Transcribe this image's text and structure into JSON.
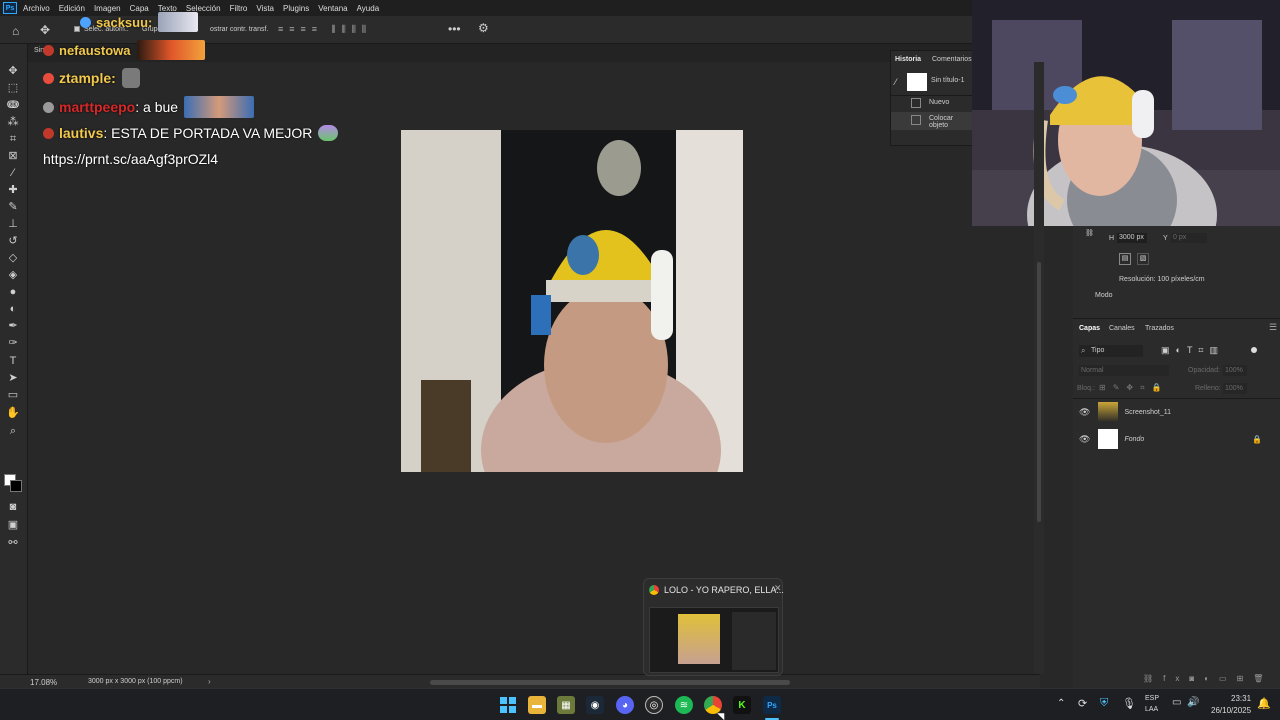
{
  "menubar": {
    "logo": "Ps",
    "items": [
      "Archivo",
      "Edición",
      "Imagen",
      "Capa",
      "Texto",
      "Selección",
      "Filtro",
      "Vista",
      "Plugins",
      "Ventana",
      "Ayuda"
    ]
  },
  "options": {
    "auto_select": "Selec. autom.:",
    "group": "Grupo",
    "show_transform": "ostrar contr. transf."
  },
  "doc_tab": "Sin tí",
  "chat": [
    {
      "user": "sacksuu:",
      "user_color": "#f2c94c",
      "badge_color": "#4da3ff",
      "text": ""
    },
    {
      "user": "nefaustowa",
      "user_color": "#f2c94c",
      "badge_color": "#c0392b",
      "text": ""
    },
    {
      "user": "ztample:",
      "user_color": "#f2c94c",
      "badge_color": "#e74c3c",
      "text": ""
    },
    {
      "user": "marttpeepo",
      "user_color": "#d62828",
      "badge_color": "#9a9a9a",
      "text": ": a bue"
    },
    {
      "user": "lautivs",
      "user_color": "#f2c94c",
      "badge_color": "#c0392b",
      "text": ": ESTA DE PORTADA VA MEJOR"
    },
    {
      "user": "",
      "user_color": "#ffffff",
      "badge_color": "",
      "text": "https://prnt.sc/aaAgf3prOZl4"
    }
  ],
  "history_panel": {
    "tab_history": "Historia",
    "tab_comments": "Comentarios",
    "snapshot": "Sin título-1",
    "steps": [
      "Nuevo",
      "Colocar objeto"
    ]
  },
  "properties": {
    "h_label": "H",
    "h_value": "3000 px",
    "y_label": "Y",
    "y_value": "0 px",
    "resolution": "Resolución: 100 píxeles/cm",
    "mode": "Modo"
  },
  "layers_panel": {
    "tabs": [
      "Capas",
      "Canales",
      "Trazados"
    ],
    "filter": "Tipo",
    "blend": "Normal",
    "opacity_label": "Opacidad:",
    "opacity_value": "100%",
    "lock_label": "Bloq.:",
    "fill_label": "Relleno:",
    "fill_value": "100%",
    "layers": [
      "Screenshot_11",
      "Fondo"
    ]
  },
  "status": {
    "zoom": "17.08%",
    "doc_info": "3000 px x 3000 px (100 ppcm)"
  },
  "preview": {
    "title": "LOLO - YO RAPERO, ELLA..."
  },
  "tray": {
    "lang1": "ESP",
    "lang2": "LAA",
    "time": "23:31",
    "date": "26/10/2025"
  }
}
